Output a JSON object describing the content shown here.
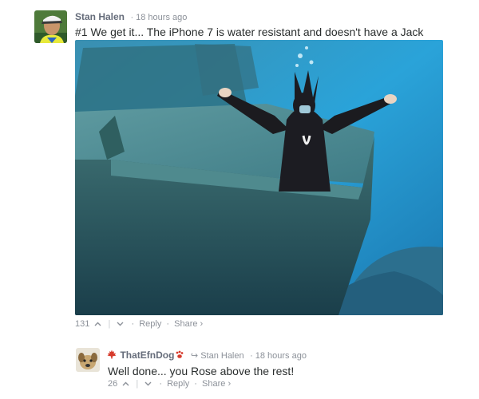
{
  "comments": [
    {
      "author": "Stan Halen",
      "separator": "·",
      "time": "18 hours ago",
      "text": "#1 We get it... The iPhone 7 is water resistant and doesn't have a Jack",
      "upvotes": "131",
      "reply_label": "Reply",
      "share_label": "Share",
      "more_glyph": "›"
    },
    {
      "author": "ThatEfnDog",
      "reply_to_glyph": "↪",
      "reply_to": "Stan Halen",
      "separator": "·",
      "time": "18 hours ago",
      "text": "Well done... you Rose above the rest!",
      "upvotes": "26",
      "reply_label": "Reply",
      "share_label": "Share",
      "more_glyph": "›"
    }
  ],
  "icons": {
    "upvote": "chevron-up-icon",
    "downvote": "chevron-down-icon",
    "maple_leaf": "maple-leaf-icon",
    "paw": "paw-print-icon"
  },
  "colors": {
    "author": "#656c7a",
    "meta": "#8c9199",
    "text": "#2a2e2e",
    "maple_leaf": "#d63a2b",
    "water": "#2a9fd6"
  }
}
